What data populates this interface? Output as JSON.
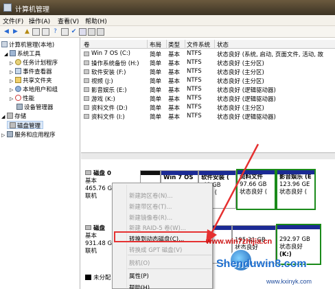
{
  "window": {
    "title": "计算机管理",
    "icon": "computer-management-icon"
  },
  "menu": [
    "文件(F)",
    "操作(A)",
    "查看(V)",
    "帮助(H)"
  ],
  "toolbar": {
    "icons": [
      "back-icon",
      "forward-icon",
      "up-icon",
      "show-hide-tree-icon",
      "properties-icon",
      "help-icon",
      "refresh-icon",
      "export-icon",
      "help-book-icon"
    ]
  },
  "tree": {
    "root": "计算机管理(本地)",
    "system_tools": "系统工具",
    "task_scheduler": "任务计划程序",
    "event_viewer": "事件查看器",
    "shared_folders": "共享文件夹",
    "local_users": "本地用户和组",
    "performance": "性能",
    "device_manager": "设备管理器",
    "storage": "存储",
    "disk_management": "磁盘管理",
    "services_apps": "服务和应用程序"
  },
  "volume_list": {
    "columns": [
      "卷",
      "布局",
      "类型",
      "文件系统",
      "状态"
    ],
    "rows": [
      [
        "Win 7 OS  (C:)",
        "简单",
        "基本",
        "NTFS",
        "状态良好 (系统, 启动, 页面文件, 活动, 故"
      ],
      [
        "操作系统备份 (H:)",
        "简单",
        "基本",
        "NTFS",
        "状态良好 (主分区)"
      ],
      [
        "软件安装 (F:)",
        "简单",
        "基本",
        "NTFS",
        "状态良好 (主分区)"
      ],
      [
        "视频 (J:)",
        "简单",
        "基本",
        "NTFS",
        "状态良好 (主分区)"
      ],
      [
        "影音娱乐 (E:)",
        "简单",
        "基本",
        "NTFS",
        "状态良好 (逻辑驱动器)"
      ],
      [
        "游戏 (K:)",
        "简单",
        "基本",
        "NTFS",
        "状态良好 (逻辑驱动器)"
      ],
      [
        "资料文件 (D:)",
        "简单",
        "基本",
        "NTFS",
        "状态良好 (主分区)"
      ],
      [
        "资料文件 (I:)",
        "简单",
        "基本",
        "NTFS",
        "状态良好 (逻辑驱动器)"
      ]
    ]
  },
  "disk0": {
    "name": "磁盘 0",
    "type": "基本",
    "size": "465.76 G",
    "status": "联机",
    "partitions": [
      {
        "name": "Win 7 OS",
        "size": "",
        "status": ""
      },
      {
        "name": "软件安装 (",
        "size": ".48 GB",
        "status": "良好 ("
      },
      {
        "name": "资料文件",
        "size": "97.66 GB",
        "status": "状态良好 ("
      },
      {
        "name": "影音娱乐 (E",
        "size": "123.96 GE",
        "status": "状态良好 ("
      }
    ]
  },
  "disk1": {
    "name": "磁盘",
    "type": "基本",
    "size": "931.48 G",
    "status": "联机",
    "partitions": [
      {
        "name": "",
        "size": "195.31 GB",
        "status": "状态良好"
      },
      {
        "name": "",
        "size": "292.97 GB",
        "status": "状态良好"
      },
      {
        "name": "(K:)",
        "size": "",
        "status": ""
      }
    ]
  },
  "legend": {
    "unallocated": "未分配"
  },
  "context_menu": {
    "items": [
      {
        "label": "新建跨区卷(N)...",
        "enabled": false
      },
      {
        "label": "新建带区卷(T)...",
        "enabled": false
      },
      {
        "label": "新建镜像卷(R)...",
        "enabled": false
      },
      {
        "label": "新建 RAID-5 卷(W)...",
        "enabled": false
      },
      {
        "label": "转换到动态磁盘(C)...",
        "enabled": true
      },
      {
        "label": "转换成 GPT 磁盘(V)",
        "enabled": false
      },
      {
        "label": "脱机(O)",
        "enabled": false
      },
      {
        "label": "属性(P)",
        "enabled": true
      },
      {
        "label": "帮助(H)",
        "enabled": true
      }
    ]
  },
  "watermarks": {
    "site1": "www.win7zhijia.cn",
    "site2": "Shenduwin8.com",
    "site3": "www.kxinyk.com"
  },
  "colors": {
    "primary_bar": "#1b2a94",
    "selected_border": "#1a8a1a",
    "highlight": "#e53030"
  }
}
